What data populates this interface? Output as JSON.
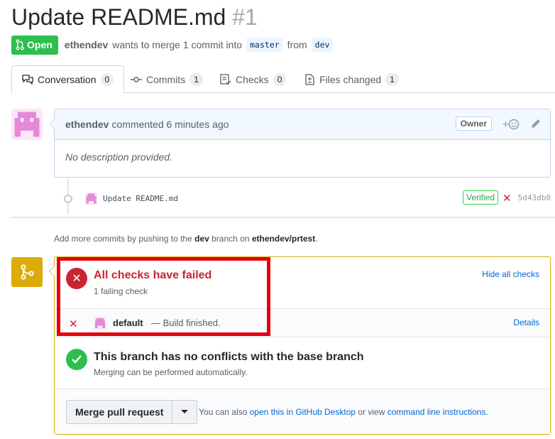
{
  "pr": {
    "title": "Update README.md",
    "number": "#1",
    "state_label": "Open",
    "author": "ethendev",
    "merge_text": "wants to merge 1 commit into",
    "base_branch": "master",
    "from_text": "from",
    "head_branch": "dev"
  },
  "tabs": [
    {
      "label": "Conversation",
      "count": "0",
      "icon": "comment-discussion-icon"
    },
    {
      "label": "Commits",
      "count": "1",
      "icon": "git-commit-icon"
    },
    {
      "label": "Checks",
      "count": "0",
      "icon": "checklist-icon"
    },
    {
      "label": "Files changed",
      "count": "1",
      "icon": "file-diff-icon"
    }
  ],
  "comment": {
    "author": "ethendev",
    "action": "commented 6 minutes ago",
    "role_label": "Owner",
    "body": "No description provided."
  },
  "commit": {
    "message": "Update README.md",
    "verified_label": "Verified",
    "sha": "5d43db0"
  },
  "push_hint": {
    "prefix": "Add more commits by pushing to the",
    "branch": "dev",
    "middle": "branch on",
    "repo": "ethendev/prtest",
    "suffix": "."
  },
  "checks": {
    "title": "All checks have failed",
    "subtitle": "1 failing check",
    "toggle_label": "Hide all checks",
    "items": [
      {
        "name": "default",
        "description": "— Build finished.",
        "details_label": "Details"
      }
    ]
  },
  "conflicts": {
    "title": "This branch has no conflicts with the base branch",
    "subtitle": "Merging can be performed automatically."
  },
  "merge": {
    "button_label": "Merge pull request",
    "hint_prefix": "You can also",
    "desktop_link": "open this in GitHub Desktop",
    "hint_middle": "or view",
    "cli_link": "command line instructions",
    "hint_suffix": "."
  },
  "colors": {
    "open_green": "#2cbe4e",
    "fail_red": "#cb2431",
    "warning_yellow": "#dbab09",
    "link_blue": "#0366d6",
    "highlight_red": "#e6000d"
  }
}
